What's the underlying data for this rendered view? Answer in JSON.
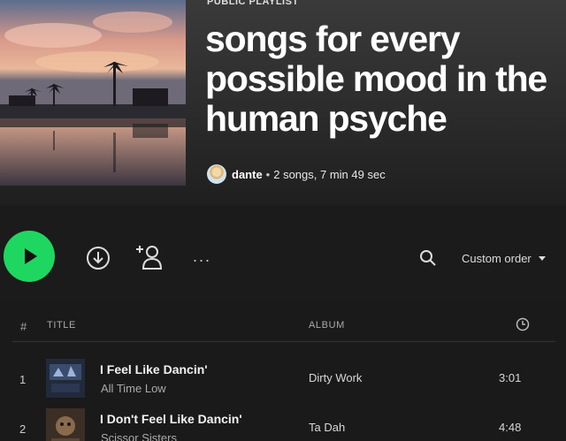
{
  "header": {
    "type_label": "PUBLIC PLAYLIST",
    "title": "songs for every possible mood in the human psyche",
    "owner": "dante",
    "separator": "•",
    "summary": "2 songs, 7 min 49 sec"
  },
  "actions": {
    "more_label": "...",
    "sort_label": "Custom order"
  },
  "table": {
    "col_num": "#",
    "col_title": "TITLE",
    "col_album": "ALBUM"
  },
  "tracks": [
    {
      "num": "1",
      "title": "I Feel Like Dancin'",
      "artist": "All Time Low",
      "album": "Dirty Work",
      "duration": "3:01"
    },
    {
      "num": "2",
      "title": "I Don't Feel Like Dancin'",
      "artist": "Scissor Sisters",
      "album": "Ta Dah",
      "duration": "4:48"
    }
  ],
  "colors": {
    "accent": "#1ed760",
    "background": "#1c1c1c"
  },
  "icons": [
    "play-icon",
    "download-icon",
    "add-user-icon",
    "search-icon",
    "clock-icon"
  ]
}
